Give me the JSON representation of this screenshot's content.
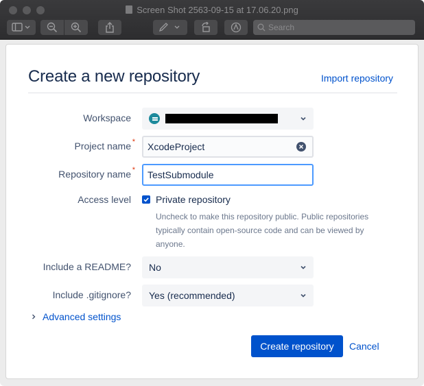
{
  "window": {
    "title": "Screen Shot 2563-09-15 at 17.06.20.png",
    "search_placeholder": "Search",
    "toolbar_icons": [
      "sidebar-icon",
      "zoom-out-icon",
      "zoom-in-icon",
      "share-icon",
      "markup-icon",
      "rotate-icon",
      "annotate-icon",
      "search-icon"
    ]
  },
  "dialog": {
    "title": "Create a new repository",
    "import_link": "Import repository",
    "fields": {
      "workspace_label": "Workspace",
      "project_label": "Project name",
      "project_value": "XcodeProject",
      "repository_label": "Repository name",
      "repository_value": "TestSubmodule",
      "access_label": "Access level",
      "private_label": "Private repository",
      "private_checked": true,
      "private_help": "Uncheck to make this repository public. Public repositories typically contain open-source code and can be viewed by anyone.",
      "readme_label": "Include a README?",
      "readme_value": "No",
      "gitignore_label": "Include .gitignore?",
      "gitignore_value": "Yes (recommended)",
      "required_marker": "*"
    },
    "advanced_settings": "Advanced settings",
    "create_button": "Create repository",
    "cancel": "Cancel"
  },
  "colors": {
    "primary": "#0052cc",
    "heading": "#172b4d",
    "label": "#42526e",
    "required": "#de350b",
    "focus_border": "#4c9aff",
    "titlebar": "#2d2d2f"
  }
}
